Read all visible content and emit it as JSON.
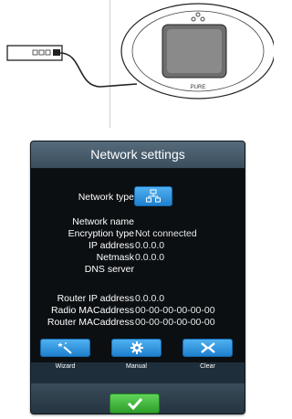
{
  "illustration": {
    "radio_brand": "PURE"
  },
  "dialog": {
    "title": "Network settings",
    "network_type_label": "Network type",
    "fields": [
      {
        "label": "Network name",
        "value": ""
      },
      {
        "label": "Encryption type",
        "value": "Not connected"
      },
      {
        "label": "IP address",
        "value": "0.0.0.0"
      },
      {
        "label": "Netmask",
        "value": "0.0.0.0"
      },
      {
        "label": "DNS server",
        "value": ""
      }
    ],
    "router_fields": [
      {
        "label": "Router IP address",
        "value": "0.0.0.0"
      },
      {
        "label": "Radio MACaddress",
        "value": "00-00-00-00-00-00"
      },
      {
        "label": "Router MACaddress",
        "value": "00-00-00-00-00-00"
      }
    ],
    "actions": [
      {
        "label": "Wizard",
        "icon": "wizard-wand-icon"
      },
      {
        "label": "Manual",
        "icon": "gear-icon"
      },
      {
        "label": "Clear",
        "icon": "clear-arrows-icon"
      }
    ],
    "confirm_icon": "checkmark-icon"
  },
  "colors": {
    "panel_bg": "#1e2e3b",
    "body_bg": "#0b0f12",
    "button_blue": "#2a8ad8",
    "confirm_green": "#3bb535"
  }
}
